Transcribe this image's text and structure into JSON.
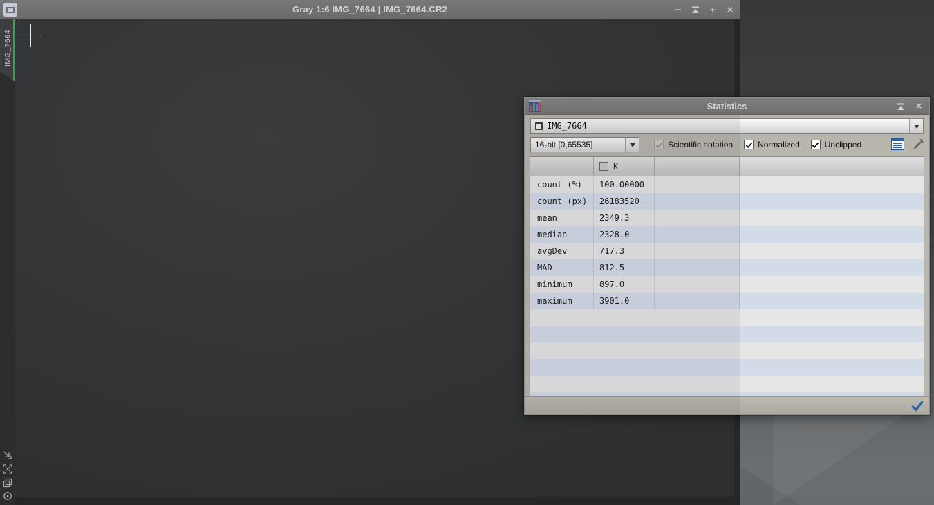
{
  "image_window": {
    "title": "Gray 1:6 IMG_7664 | IMG_7664.CR2",
    "tab_label": "IMG_7664",
    "controls": {
      "minimize": "−",
      "maximize": "+",
      "close": "×"
    }
  },
  "dialog": {
    "title": "Statistics",
    "controls": {
      "close": "×"
    },
    "view_selector": {
      "value": "IMG_7664"
    },
    "range_selector": {
      "value": "16-bit [0,65535]"
    },
    "options": {
      "scientific_notation": {
        "label": "Scientific notation",
        "checked": true,
        "disabled": true
      },
      "normalized": {
        "label": "Normalized",
        "checked": true,
        "disabled": false
      },
      "unclipped": {
        "label": "Unclipped",
        "checked": true,
        "disabled": false
      }
    },
    "table": {
      "columns": [
        "",
        "K",
        "",
        ""
      ],
      "rows": [
        {
          "label": "count (%)",
          "value": "100.00000"
        },
        {
          "label": "count (px)",
          "value": "26183520"
        },
        {
          "label": "mean",
          "value": "2349.3"
        },
        {
          "label": "median",
          "value": "2328.0"
        },
        {
          "label": "avgDev",
          "value": "717.3"
        },
        {
          "label": "MAD",
          "value": "812.5"
        },
        {
          "label": "minimum",
          "value": "897.0"
        },
        {
          "label": "maximum",
          "value": "3901.0"
        }
      ]
    }
  },
  "colors": {
    "accent_blue": "#2b66a3",
    "tab_green": "#2ea84d",
    "row_even": "#d4dbe8",
    "row_odd": "#e6e6e7"
  }
}
